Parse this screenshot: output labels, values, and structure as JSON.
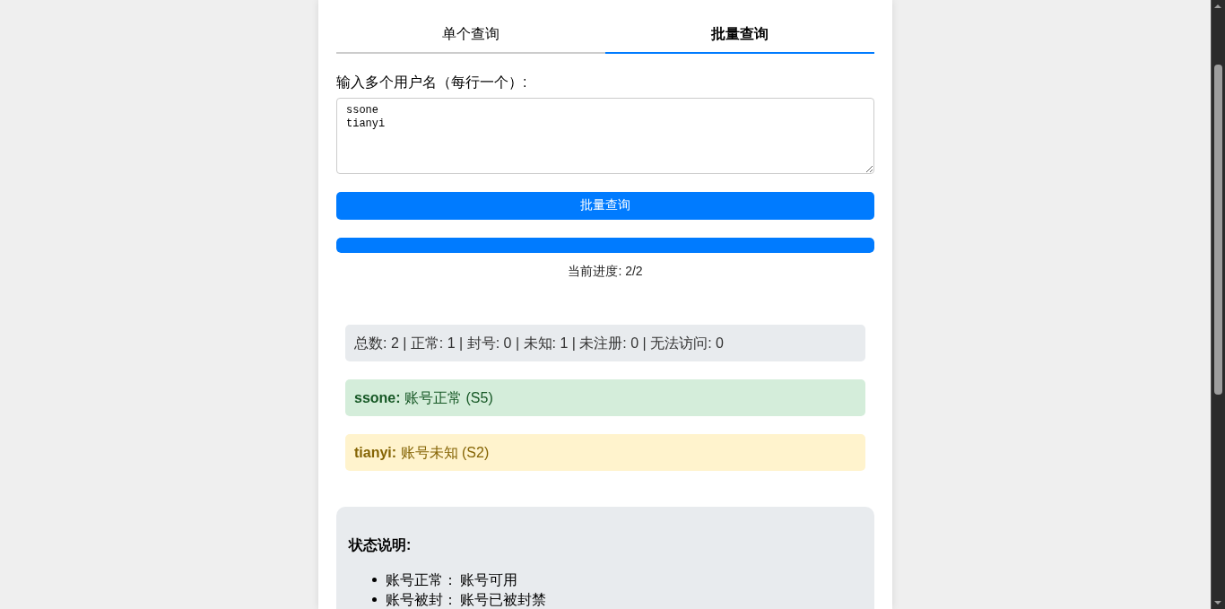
{
  "tabs": [
    {
      "label": "单个查询",
      "selected": false
    },
    {
      "label": "批量查询",
      "selected": true
    }
  ],
  "input": {
    "label": "输入多个用户名（每行一个）:",
    "value": "ssone\ntianyi"
  },
  "submit_button": "批量查询",
  "progress": {
    "level": 1,
    "text": "当前进度: 2/2"
  },
  "summary": "总数: 2 | 正常: 1 | 封号: 0 | 未知: 1 | 未注册: 0 | 无法访问: 0",
  "results": [
    {
      "username": "ssone:",
      "status": "账号正常 (S5)",
      "kind": "normal"
    },
    {
      "username": "tianyi:",
      "status": "账号未知 (S2)",
      "kind": "unknown"
    }
  ],
  "legend": {
    "title": "状态说明:",
    "items": [
      {
        "label": "账号正常：",
        "desc": "账号可用"
      },
      {
        "label": "账号被封：",
        "desc": "账号已被封禁"
      }
    ]
  }
}
